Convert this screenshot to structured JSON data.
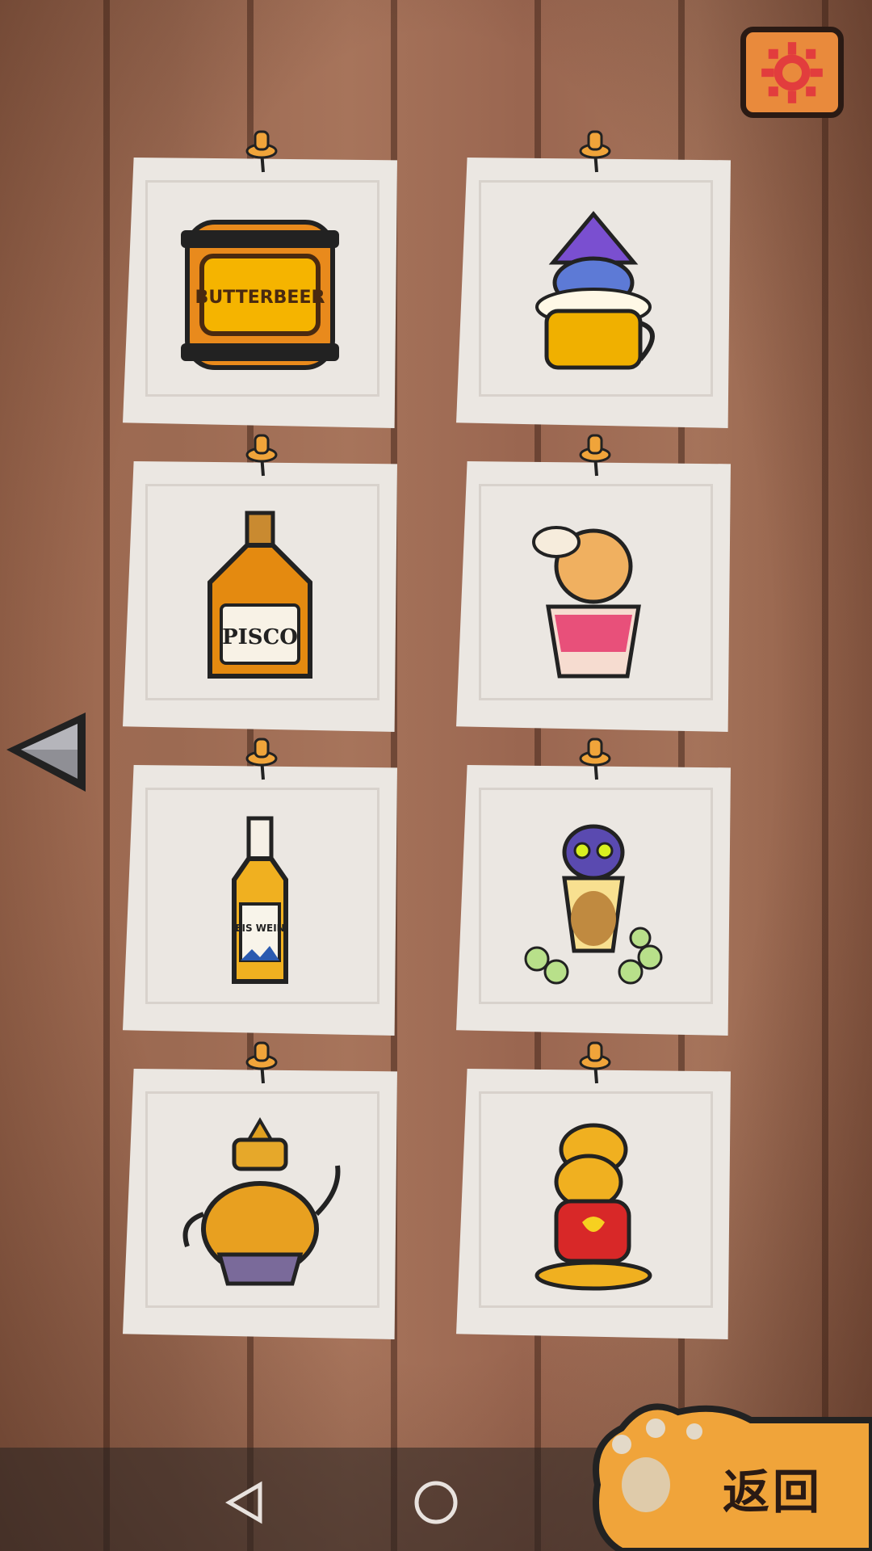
{
  "settings": {
    "icon": "gear-icon",
    "color": "#e98a3c"
  },
  "navigation": {
    "prev_icon": "left-triangle-icon"
  },
  "cards": [
    {
      "name": "butterbeer-barrel",
      "icon": "barrel-icon",
      "label": "BUTTERBEER"
    },
    {
      "name": "wizard-cat-beer-mug",
      "icon": "wizard-cat-mug-icon"
    },
    {
      "name": "pisco-bottle",
      "icon": "bottle-icon",
      "label": "PISCO"
    },
    {
      "name": "llama-cat-cocktail",
      "icon": "llama-cat-icon"
    },
    {
      "name": "eiswein-bottle",
      "icon": "bottle-icon",
      "label": "EIS WEIN"
    },
    {
      "name": "cat-grape-glass",
      "icon": "cat-glass-icon"
    },
    {
      "name": "ornate-teapot",
      "icon": "teapot-icon"
    },
    {
      "name": "cat-in-red-vest",
      "icon": "cat-vest-icon"
    }
  ],
  "back_button": {
    "label": "返回",
    "icon": "paw-icon",
    "color": "#f0a43a"
  },
  "system_nav": {
    "back_icon": "nav-back-icon",
    "home_icon": "nav-home-icon",
    "recents_icon": "nav-recents-icon"
  }
}
